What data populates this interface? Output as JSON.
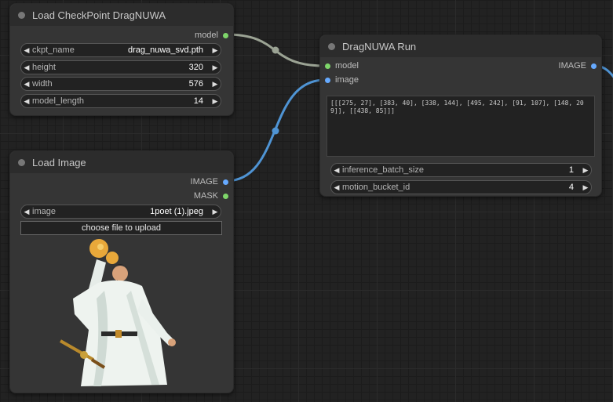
{
  "colors": {
    "model_wire": "#9ba394",
    "image_wire": "#4f94d4",
    "model_pin": "#7ed66a",
    "image_pin": "#66aaff",
    "mask_pin": "#7ed66a"
  },
  "checkpoint_node": {
    "title": "Load CheckPoint DragNUWA",
    "output_model": "model",
    "widgets": {
      "ckpt_name": {
        "label": "ckpt_name",
        "value": "drag_nuwa_svd.pth"
      },
      "height": {
        "label": "height",
        "value": "320"
      },
      "width": {
        "label": "width",
        "value": "576"
      },
      "model_length": {
        "label": "model_length",
        "value": "14"
      }
    }
  },
  "image_node": {
    "title": "Load Image",
    "output_image": "IMAGE",
    "output_mask": "MASK",
    "widget_image": {
      "label": "image",
      "value": "1poet (1).jpeg"
    },
    "upload_label": "choose file to upload",
    "preview_icon": "poet-figure-image"
  },
  "run_node": {
    "title": "DragNUWA Run",
    "input_model": "model",
    "input_image": "image",
    "output_image": "IMAGE",
    "tracking_points": "[[[275, 27], [383, 40], [338, 144], [495, 242], [91, 107], [148, 209]], [[438, 85]]]",
    "widgets": {
      "inference_batch_size": {
        "label": "inference_batch_size",
        "value": "1"
      },
      "motion_bucket_id": {
        "label": "motion_bucket_id",
        "value": "4"
      }
    }
  }
}
